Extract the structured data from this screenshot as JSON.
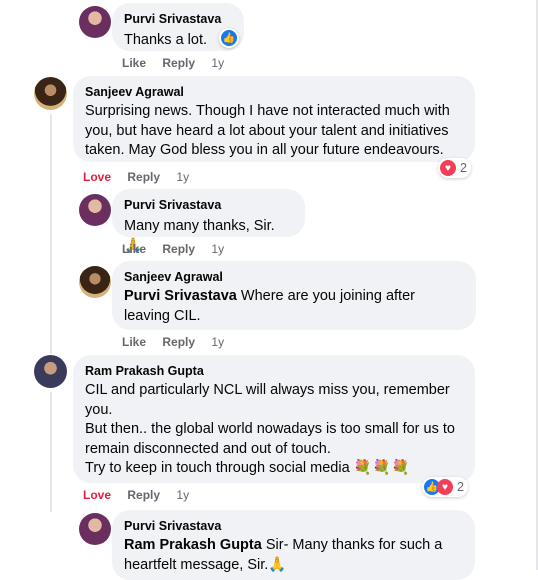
{
  "actions": {
    "like": "Like",
    "love": "Love",
    "reply": "Reply",
    "time": "1y"
  },
  "comments": [
    {
      "author": "Purvi Srivastava",
      "text": "Thanks a lot."
    },
    {
      "author": "Sanjeev Agrawal",
      "text": "Surprising news. Though I have not interacted much with you, but have heard a lot about your talent and initiatives taken. May God bless you in all your future endeavours.",
      "reaction_count": "2"
    },
    {
      "author": "Purvi Srivastava",
      "text": "Many many thanks, Sir. 🙏"
    },
    {
      "author": "Sanjeev Agrawal",
      "mention": "Purvi Srivastava",
      "text": " Where are you joining after leaving CIL."
    },
    {
      "author": "Ram Prakash Gupta",
      "line1": "CIL and particularly NCL will always miss you, remember you.",
      "line2": "But then.. the global world nowadays is too small for us to remain disconnected and out of touch.",
      "line3": "Try to keep in touch through social media",
      "flowers": "💐💐💐",
      "reaction_count": "2"
    },
    {
      "author": "Purvi Srivastava",
      "mention": "Ram Prakash Gupta",
      "text": " Sir- Many thanks for such a heartfelt message, Sir.🙏"
    }
  ],
  "colors": {
    "bubble": "#f0f2f5",
    "love": "#e41e3f",
    "like_blue": "#1877f2",
    "meta": "#65676b"
  }
}
